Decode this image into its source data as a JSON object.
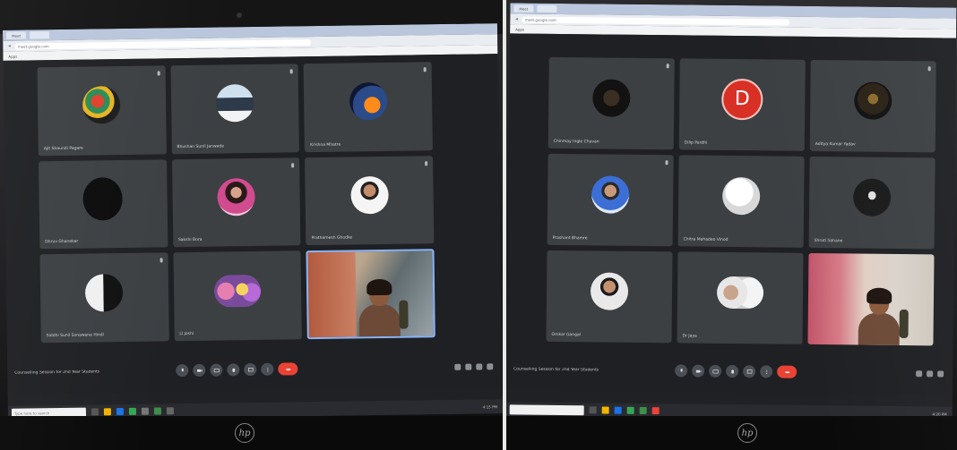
{
  "left_photo": {
    "browser": {
      "tab_label": "Meet",
      "address": "meet.google.com",
      "bookmark": "Apps"
    },
    "meeting_title": "Counselling Session for 2nd Year Students",
    "tiles": [
      {
        "name": "Ajit Shaundi Pagare",
        "avatar": "artwork-avatar"
      },
      {
        "name": "Bhushan Sunil Janwade",
        "avatar": "couple-photo-avatar"
      },
      {
        "name": "Krishna Mhatre",
        "avatar": "fire-art-avatar"
      },
      {
        "name": "Dhruv Ghanekar",
        "avatar": "dark-avatar"
      },
      {
        "name": "Sakshi Bora",
        "avatar": "woman-photo-avatar"
      },
      {
        "name": "Prathamesh Ghodke",
        "avatar": "man-photo-avatar"
      },
      {
        "name": "Siddhi Sunil Sonawane Hindi",
        "avatar": "bw-portrait-avatar"
      },
      {
        "name": "Ll Joshi",
        "avatar": "flowers-avatar"
      },
      {
        "name": "",
        "avatar": "live-video"
      }
    ],
    "taskbar": {
      "search_placeholder": "Type here to search",
      "time": "4:15 PM"
    },
    "brand": "hp"
  },
  "right_photo": {
    "browser": {
      "tab_label": "Meet",
      "address": "meet.google.com",
      "bookmark": "Apps"
    },
    "meeting_title": "Counselling Session for 2nd Year Students",
    "tiles": [
      {
        "name": "Chinmay Ingle Chavan",
        "avatar": "dark-photo-avatar"
      },
      {
        "name": "Dilip Pardhi",
        "avatar": "letter-avatar",
        "letter": "D"
      },
      {
        "name": "Aditya Kumar Yadav",
        "avatar": "dark-art-avatar"
      },
      {
        "name": "Prashant Bhamre",
        "avatar": "man-blue-avatar"
      },
      {
        "name": "Chitra Mahadeo Vinod",
        "avatar": "white-avatar"
      },
      {
        "name": "Shruti Sahane",
        "avatar": "silhouette-avatar"
      },
      {
        "name": "Omkar Gangal",
        "avatar": "man-photo-avatar"
      },
      {
        "name": "Dr Jaya",
        "avatar": "group-avatar"
      },
      {
        "name": "",
        "avatar": "live-video"
      }
    ],
    "taskbar": {
      "search_placeholder": "",
      "time": "4:20 PM"
    },
    "brand": "hp"
  },
  "colors": {
    "meet_background": "#202124",
    "tile_background": "#3c4043",
    "end_call": "#ea4335",
    "letter_avatar": "#d93025"
  }
}
